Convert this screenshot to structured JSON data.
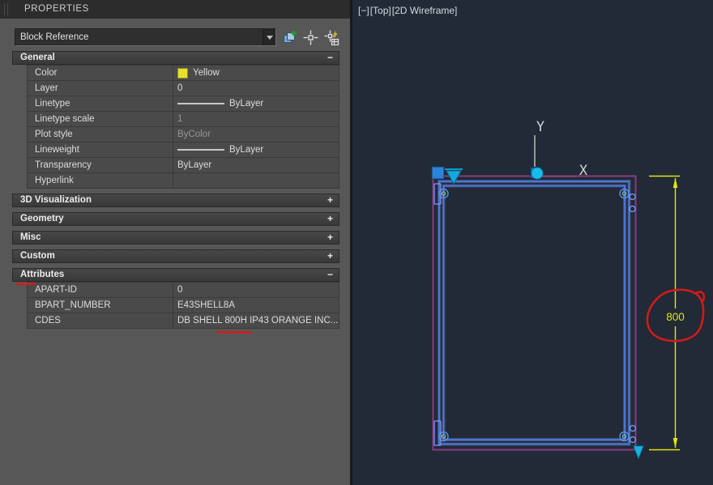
{
  "panel": {
    "title": "PROPERTIES",
    "selector": {
      "value": "Block Reference"
    },
    "toolbar": {
      "icons": [
        "toggle-pickadd-icon",
        "select-objects-icon",
        "quick-select-icon"
      ]
    },
    "sections": {
      "general": {
        "label": "General",
        "toggle": "−",
        "rows": {
          "color": {
            "label": "Color",
            "value": "Yellow",
            "swatch": "#e8df2e"
          },
          "layer": {
            "label": "Layer",
            "value": "0"
          },
          "linetype": {
            "label": "Linetype",
            "value": "ByLayer"
          },
          "linetype_scale": {
            "label": "Linetype scale",
            "value": "1"
          },
          "plot_style": {
            "label": "Plot style",
            "value": "ByColor"
          },
          "lineweight": {
            "label": "Lineweight",
            "value": "ByLayer"
          },
          "transparency": {
            "label": "Transparency",
            "value": "ByLayer"
          },
          "hyperlink": {
            "label": "Hyperlink",
            "value": ""
          }
        }
      },
      "viz3d": {
        "label": "3D Visualization",
        "toggle": "+"
      },
      "geometry": {
        "label": "Geometry",
        "toggle": "+"
      },
      "misc": {
        "label": "Misc",
        "toggle": "+"
      },
      "custom": {
        "label": "Custom",
        "toggle": "+"
      },
      "attributes": {
        "label": "Attributes",
        "toggle": "−",
        "rows": {
          "apart_id": {
            "label": "APART-ID",
            "value": "0"
          },
          "bpart_number": {
            "label": "BPART_NUMBER",
            "value": "E43SHELL8A"
          },
          "cdes": {
            "label": "CDES",
            "value": "DB SHELL 800H IP43 ORANGE INC..."
          }
        }
      }
    }
  },
  "viewport": {
    "controls": {
      "minimize": "[−]",
      "view": "[Top]",
      "visual_style": "[2D Wireframe]"
    },
    "ucs": {
      "x_label": "X",
      "y_label": "Y"
    },
    "dimension": {
      "text": "800"
    },
    "colors": {
      "background": "#212a36",
      "block_outline": "#8a3a86",
      "shape": "#4d7df2",
      "grip_blue": "#2b84d9",
      "grip_cyan": "#17bcec",
      "dimension": "#e6e410",
      "annotation": "#d11a1a"
    }
  }
}
